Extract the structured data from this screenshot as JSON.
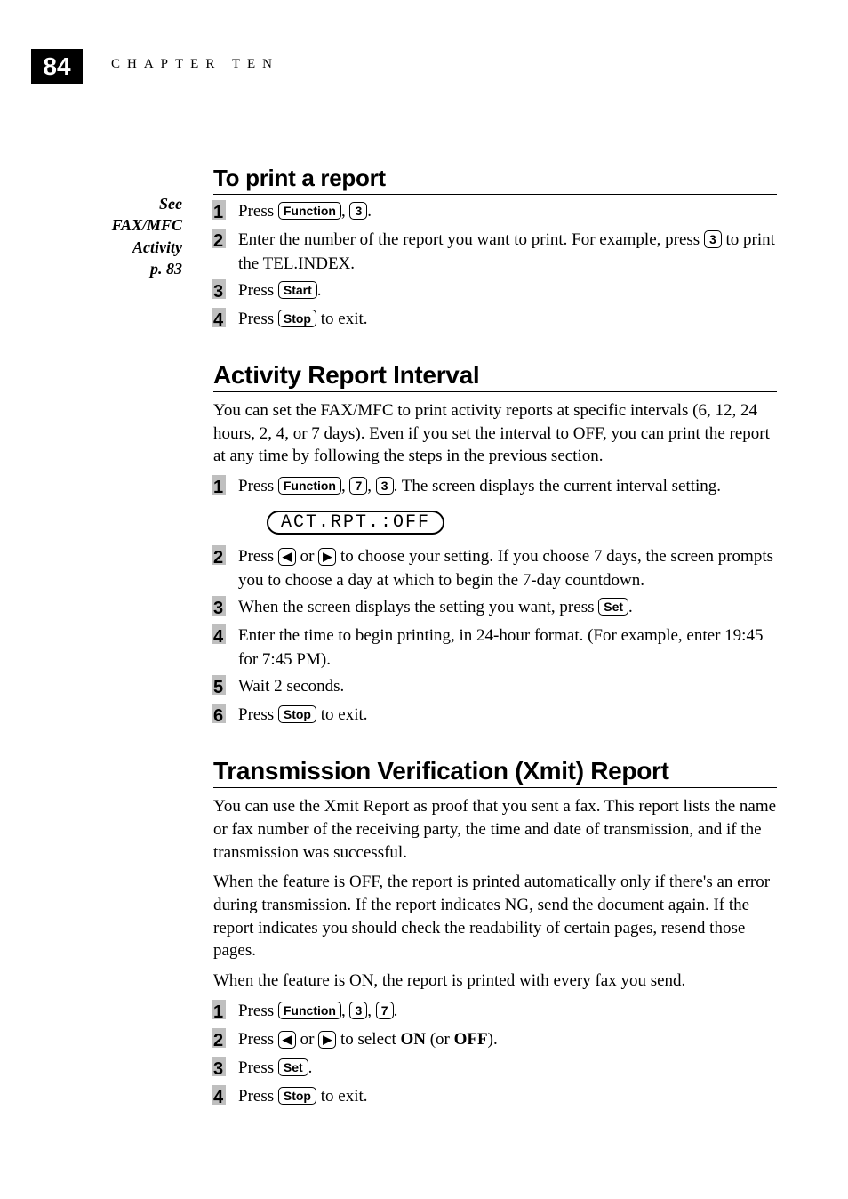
{
  "page_number": "84",
  "chapter_head": "CHAPTER TEN",
  "sidebar": {
    "line1": "See",
    "line2": "FAX/MFC",
    "line3": "Activity",
    "line4": "p. 83"
  },
  "section1": {
    "title": "To print a report",
    "steps": [
      {
        "n": "1",
        "pre": "Press ",
        "key1": "Function",
        "mid": ", ",
        "key2": "3",
        "post": "."
      },
      {
        "n": "2",
        "pre": "Enter the number of the report you want to print.  For example, press ",
        "key1": "3",
        "post": " to print the TEL.INDEX."
      },
      {
        "n": "3",
        "pre": "Press ",
        "key1": "Start",
        "post": "."
      },
      {
        "n": "4",
        "pre": "Press ",
        "key1": "Stop",
        "post": " to exit."
      }
    ]
  },
  "section2": {
    "title": "Activity Report Interval",
    "intro": "You can set the FAX/MFC to print activity reports at specific intervals (6, 12, 24 hours, 2, 4, or 7 days).  Even if you set the interval to OFF, you can print the report at any time by following the steps in the previous section.",
    "lcd": "ACT.RPT.:OFF",
    "step1": {
      "n": "1",
      "pre": "Press ",
      "k1": "Function",
      "m1": ", ",
      "k2": "7",
      "m2": ", ",
      "k3": "3",
      "post": ".  The screen displays the current interval setting."
    },
    "step2": {
      "n": "2",
      "pre": "Press ",
      "k1": "◀",
      "m1": " or ",
      "k2": "▶",
      "post": " to choose your setting.  If you choose 7 days, the screen prompts you to choose a day at which to begin the 7-day countdown."
    },
    "step3": {
      "n": "3",
      "pre": "When the screen displays the setting you want, press ",
      "k1": "Set",
      "post": "."
    },
    "step4": {
      "n": "4",
      "text": "Enter the time to begin printing, in 24-hour format.  (For example, enter 19:45 for 7:45 PM)."
    },
    "step5": {
      "n": "5",
      "text": "Wait 2 seconds."
    },
    "step6": {
      "n": "6",
      "pre": "Press ",
      "k1": "Stop",
      "post": " to exit."
    }
  },
  "section3": {
    "title": "Transmission Verification (Xmit) Report",
    "p1": "You can use the Xmit Report as proof that you sent a fax.  This report lists the name or fax number of the receiving party, the time and date of transmission, and if the transmission was successful.",
    "p2": "When the feature is OFF, the report is printed automatically only if there's an error during transmission.  If the report indicates NG, send the document again.  If the report indicates you should check the readability of certain pages, resend those pages.",
    "p3": "When the feature is ON, the report is printed with every fax you send.",
    "step1": {
      "n": "1",
      "pre": "Press ",
      "k1": "Function",
      "m1": ", ",
      "k2": "3",
      "m2": ", ",
      "k3": "7",
      "post": "."
    },
    "step2": {
      "n": "2",
      "pre": "Press ",
      "k1": "◀",
      "m1": " or ",
      "k2": "▶",
      "m2": " to select ",
      "bold1": "ON",
      "m3": " (or ",
      "bold2": "OFF",
      "post": ")."
    },
    "step3": {
      "n": "3",
      "pre": "Press ",
      "k1": "Set",
      "post": "."
    },
    "step4": {
      "n": "4",
      "pre": "Press ",
      "k1": "Stop",
      "post": " to exit."
    }
  }
}
